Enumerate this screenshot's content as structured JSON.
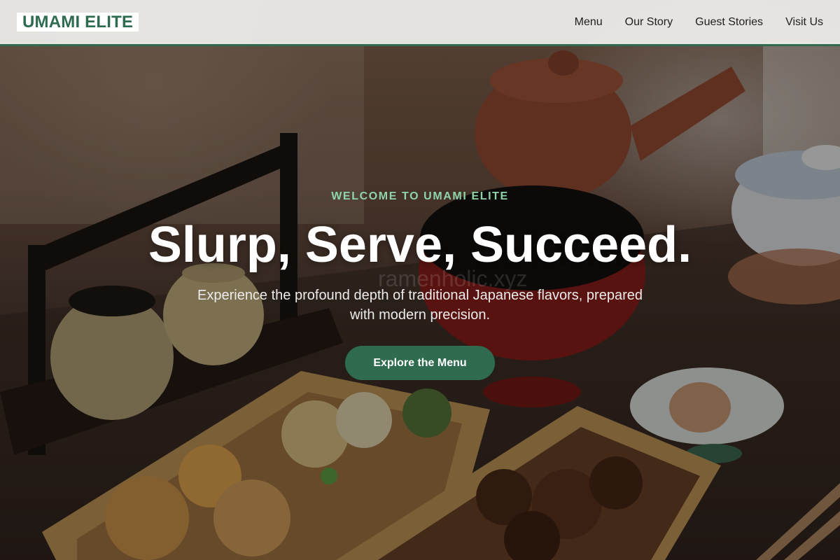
{
  "header": {
    "logo": "UMAMI ELITE",
    "nav": [
      "Menu",
      "Our Story",
      "Guest Stories",
      "Visit Us"
    ]
  },
  "hero": {
    "eyebrow": "WELCOME TO UMAMI ELITE",
    "headline": "Slurp, Serve, Succeed.",
    "subline": "Experience the profound depth of traditional Japanese flavors, prepared with modern precision.",
    "cta": "Explore the Menu",
    "watermark": "ramenholic.xyz",
    "image": "japanese-bento-tea-set-photo"
  },
  "colors": {
    "brand_green": "#2e6b4f",
    "eyebrow_green": "#8fd4a8",
    "header_bg": "#f0f0ee"
  }
}
